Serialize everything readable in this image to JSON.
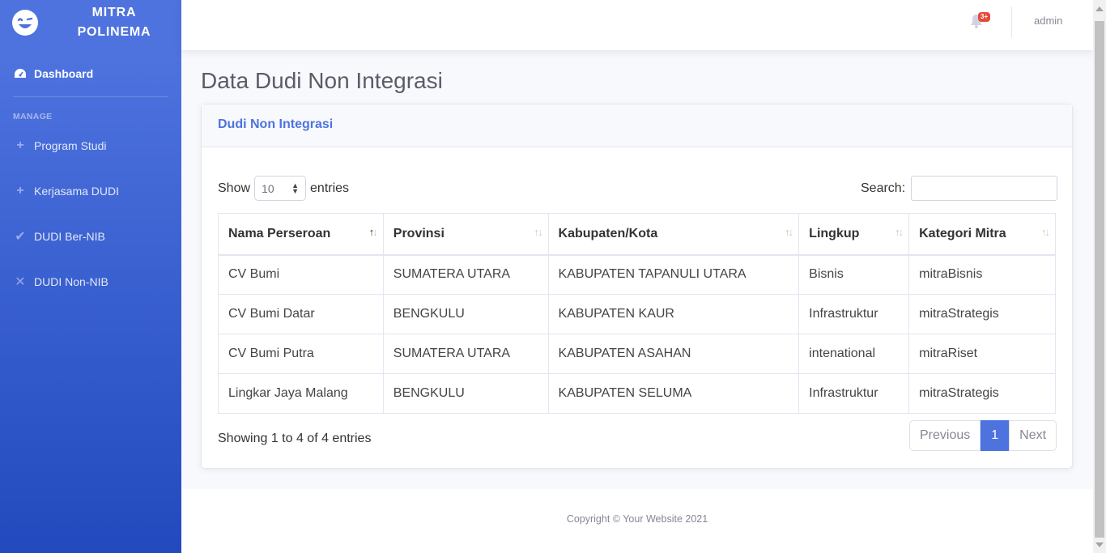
{
  "brand": {
    "line1": "MITRA",
    "line2": "POLINEMA",
    "icon": "laugh-wink-icon"
  },
  "sidebar": {
    "dashboard": {
      "label": "Dashboard",
      "icon": "tachometer-icon"
    },
    "heading": "MANAGE",
    "items": [
      {
        "label": "Program Studi",
        "icon": "plus-icon"
      },
      {
        "label": "Kerjasama DUDI",
        "icon": "plus-icon"
      },
      {
        "label": "DUDI Ber-NIB",
        "icon": "check-icon"
      },
      {
        "label": "DUDI Non-NIB",
        "icon": "times-icon"
      }
    ]
  },
  "topbar": {
    "alerts_badge": "3+",
    "user": "admin"
  },
  "page": {
    "title": "Data Dudi Non Integrasi"
  },
  "card": {
    "title": "Dudi Non Integrasi"
  },
  "table_controls": {
    "show_label": "Show",
    "entries_value": "10",
    "entries_label": "entries",
    "search_label": "Search:",
    "search_value": ""
  },
  "table": {
    "columns": [
      "Nama Perseroan",
      "Provinsi",
      "Kabupaten/Kota",
      "Lingkup",
      "Kategori Mitra"
    ],
    "rows": [
      [
        "CV Bumi",
        "SUMATERA UTARA",
        "KABUPATEN TAPANULI UTARA",
        "Bisnis",
        "mitraBisnis"
      ],
      [
        "CV Bumi Datar",
        "BENGKULU",
        "KABUPATEN KAUR",
        "Infrastruktur",
        "mitraStrategis"
      ],
      [
        "CV Bumi Putra",
        "SUMATERA UTARA",
        "KABUPATEN ASAHAN",
        "intenational",
        "mitraRiset"
      ],
      [
        "Lingkar Jaya Malang",
        "BENGKULU",
        "KABUPATEN SELUMA",
        "Infrastruktur",
        "mitraStrategis"
      ]
    ]
  },
  "pagination": {
    "info": "Showing 1 to 4 of 4 entries",
    "previous": "Previous",
    "current": "1",
    "next": "Next"
  },
  "footer": {
    "copyright": "Copyright © Your Website 2021"
  },
  "colors": {
    "primary": "#4e73df",
    "primary_dark": "#224abe",
    "danger": "#e74a3b"
  }
}
